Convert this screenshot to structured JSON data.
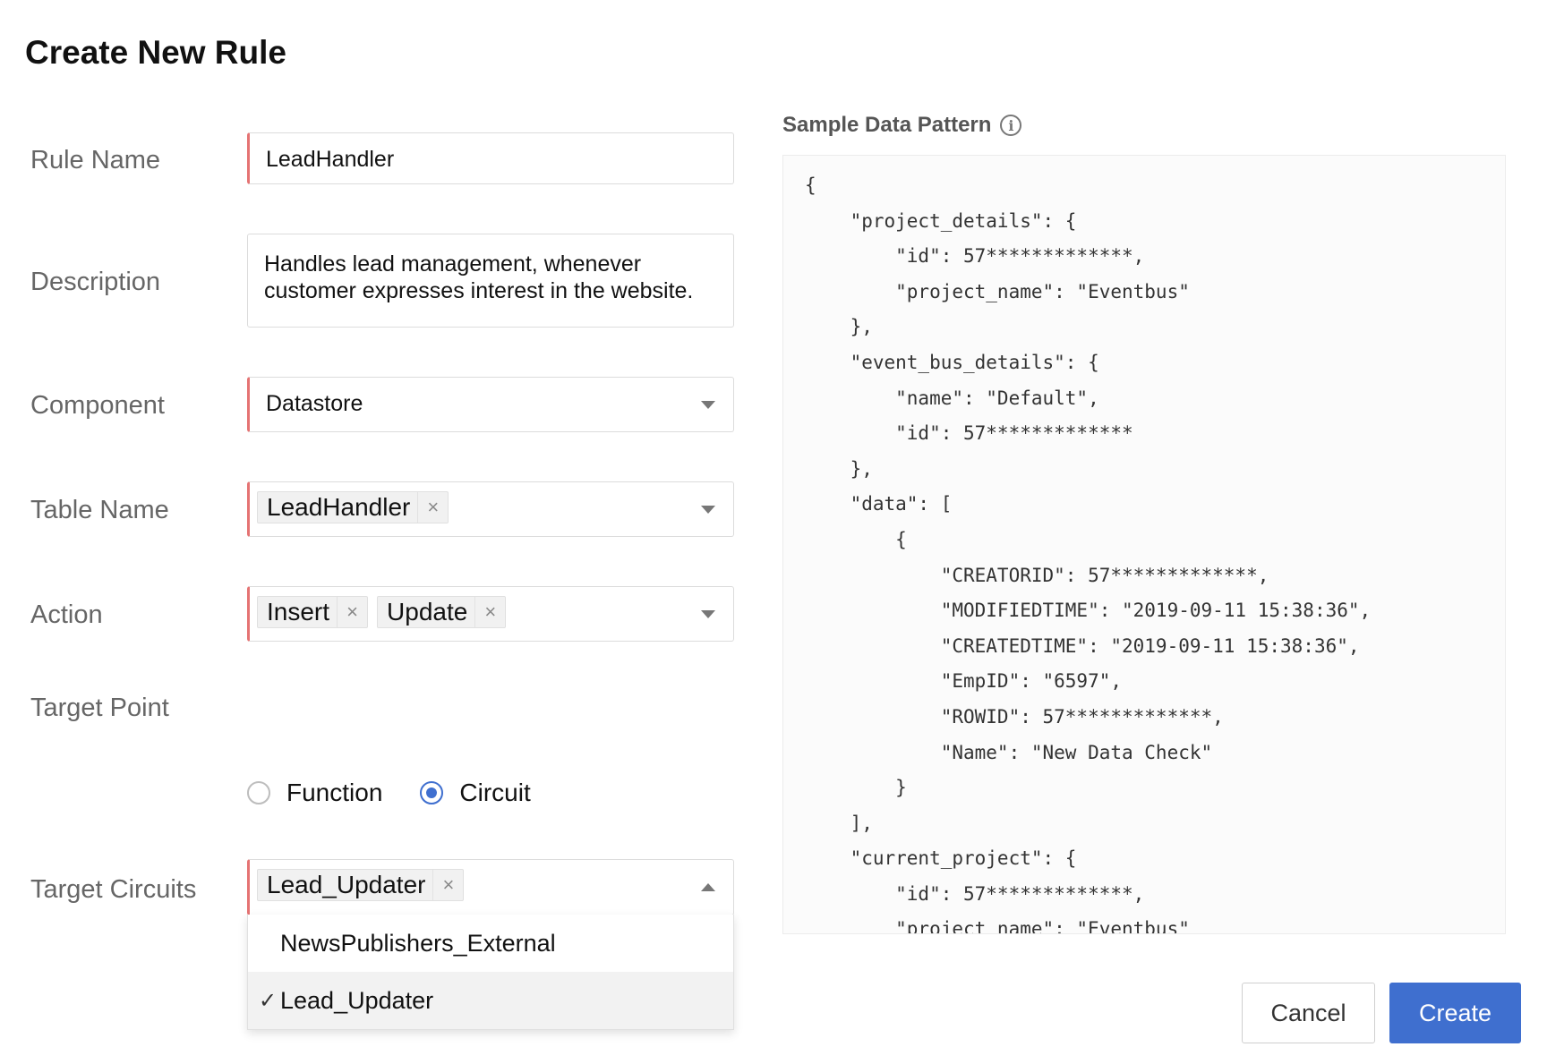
{
  "page": {
    "title": "Create New Rule"
  },
  "form": {
    "rule_name": {
      "label": "Rule Name",
      "value": "LeadHandler"
    },
    "description": {
      "label": "Description",
      "value": "Handles lead management, whenever\ncustomer expresses interest in the website."
    },
    "component": {
      "label": "Component",
      "value": "Datastore"
    },
    "table_name": {
      "label": "Table Name",
      "chips": [
        "LeadHandler"
      ]
    },
    "action": {
      "label": "Action",
      "chips": [
        "Insert",
        "Update"
      ]
    },
    "target_point": {
      "label": "Target Point",
      "options": [
        "Function",
        "Circuit"
      ],
      "selected": "Circuit"
    },
    "target_circuits": {
      "label": "Target Circuits",
      "chips": [
        "Lead_Updater"
      ],
      "dropdown_open": true,
      "options": [
        "NewsPublishers_External",
        "Lead_Updater"
      ],
      "selected": "Lead_Updater",
      "check_glyph": "✓"
    },
    "chip_remove_glyph": "×"
  },
  "sample": {
    "title": "Sample Data Pattern",
    "info_glyph": "i",
    "code": "{\n    \"project_details\": {\n        \"id\": 57*************,\n        \"project_name\": \"Eventbus\"\n    },\n    \"event_bus_details\": {\n        \"name\": \"Default\",\n        \"id\": 57*************\n    },\n    \"data\": [\n        {\n            \"CREATORID\": 57*************,\n            \"MODIFIEDTIME\": \"2019-09-11 15:38:36\",\n            \"CREATEDTIME\": \"2019-09-11 15:38:36\",\n            \"EmpID\": \"6597\",\n            \"ROWID\": 57*************,\n            \"Name\": \"New Data Check\"\n        }\n    ],\n    \"current_project\": {\n        \"id\": 57*************,\n        \"project_name\": \"Eventbus\""
  },
  "buttons": {
    "cancel": "Cancel",
    "create": "Create"
  },
  "colors": {
    "primary": "#3f6fcf",
    "required_marker": "#e57373"
  }
}
